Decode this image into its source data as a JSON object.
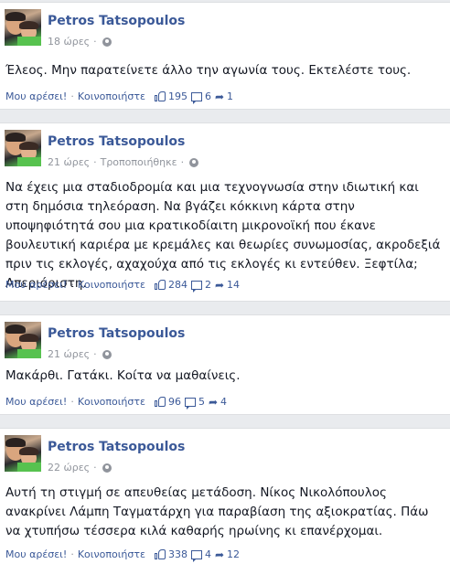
{
  "posts": [
    {
      "author": "Petros Tatsopoulos",
      "time": "18 ώρες",
      "edited": "",
      "text": "Έλεος. Μην παρατείνετε άλλο την αγωνία τους. Εκτελέστε τους.",
      "like_label": "Μου αρέσει!",
      "share_label": "Κοινοποιήστε",
      "likes": "195",
      "comments": "6",
      "shares": "1"
    },
    {
      "author": "Petros Tatsopoulos",
      "time": "21 ώρες",
      "edited": "Τροποποιήθηκε",
      "text": "Να έχεις μια σταδιοδρομία και μια τεχνογνωσία στην ιδιωτική και στη δημόσια τηλεόραση. Να βγάζει κόκκινη κάρτα στην υποψηφιότητά σου μια κρατικοδίαιτη μικρονοϊκή που έκανε βουλευτική καριέρα με κρεμάλες και θεωρίες συνωμοσίας, ακροδεξιά πριν τις εκλογές, αχαχούχα από τις εκλογές κι εντεύθεν. Ξεφτίλα; Απεριόριστη.",
      "like_label": "Μου αρέσει!",
      "share_label": "Κοινοποιήστε",
      "likes": "284",
      "comments": "2",
      "shares": "14"
    },
    {
      "author": "Petros Tatsopoulos",
      "time": "21 ώρες",
      "edited": "",
      "text": "Μακάρθι. Γατάκι. Κοίτα να μαθαίνεις.",
      "like_label": "Μου αρέσει!",
      "share_label": "Κοινοποιήστε",
      "likes": "96",
      "comments": "5",
      "shares": "4"
    },
    {
      "author": "Petros Tatsopoulos",
      "time": "22 ώρες",
      "edited": "",
      "text": "Αυτή τη στιγμή σε απευθείας μετάδοση. Νίκος Νικολόπουλος ανακρίνει Λάμπη Ταγματάρχη για παραβίαση της αξιοκρατίας. Πάω να χτυπήσω τέσσερα κιλά καθαρής ηρωίνης κι επανέρχομαι.",
      "like_label": "Μου αρέσει!",
      "share_label": "Κοινοποιήστε",
      "likes": "338",
      "comments": "4",
      "shares": "12"
    }
  ],
  "colors": {
    "link": "#3b5998",
    "meta": "#90949c",
    "background": "#e9ebee"
  },
  "icons": [
    "globe-icon",
    "like-icon",
    "comment-icon",
    "share-icon"
  ]
}
